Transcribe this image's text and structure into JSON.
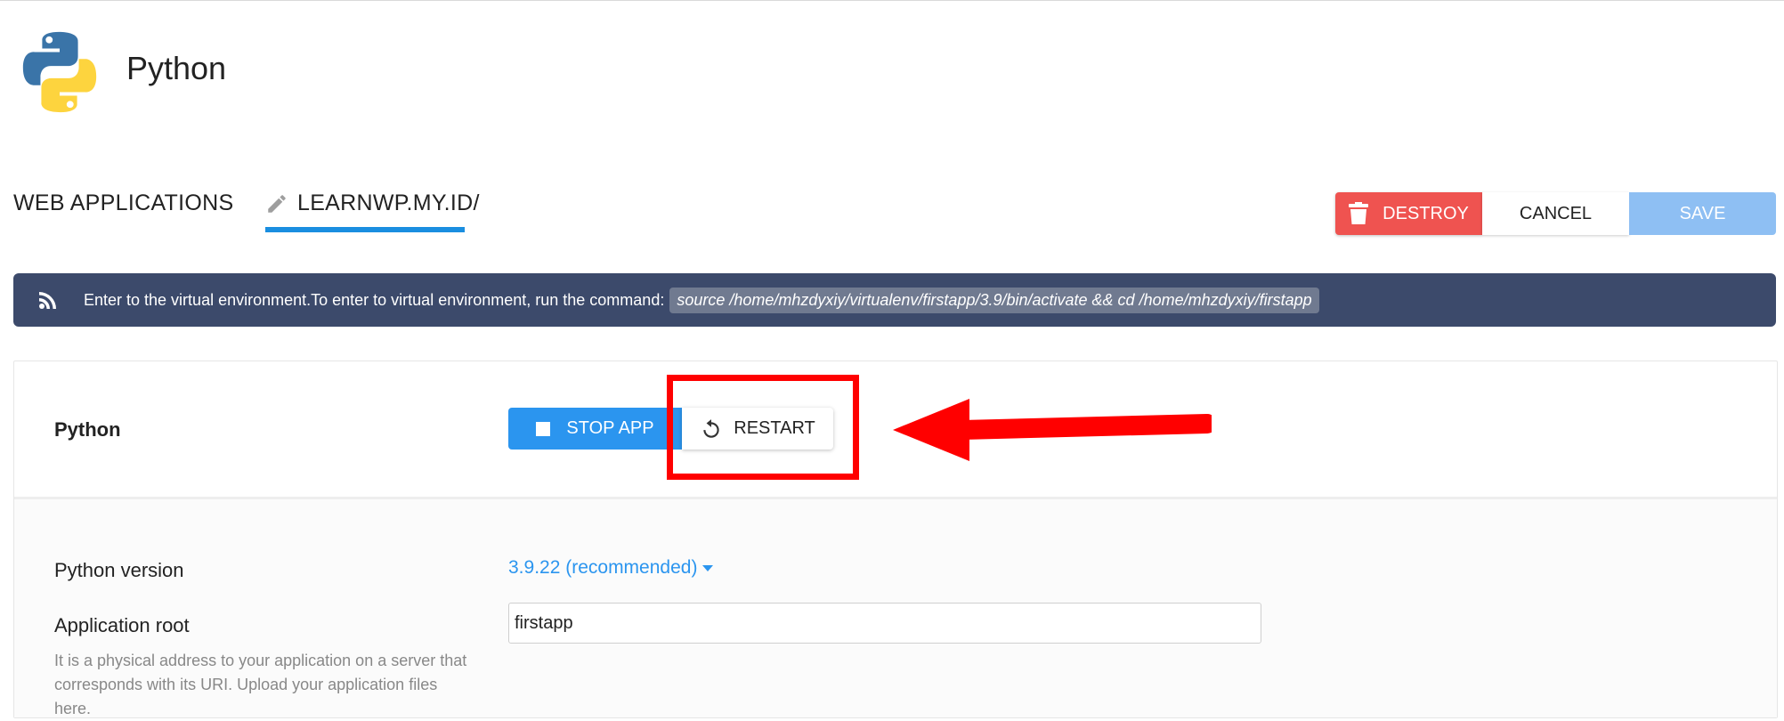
{
  "header": {
    "title": "Python",
    "logo_icon": "python-logo-icon"
  },
  "tabs": [
    {
      "label": "WEB APPLICATIONS"
    },
    {
      "label": "LEARNWP.MY.ID/",
      "icon": "pencil-icon",
      "active": true
    }
  ],
  "actions": {
    "destroy": "DESTROY",
    "cancel": "CANCEL",
    "save": "SAVE"
  },
  "banner": {
    "icon": "rss-icon",
    "text": "Enter to the virtual environment.To enter to virtual environment, run the command:",
    "command": "source /home/mhzdyxiy/virtualenv/firstapp/3.9/bin/activate && cd /home/mhzdyxiy/firstapp"
  },
  "app_panel": {
    "name": "Python",
    "stop_label": "STOP APP",
    "restart_label": "RESTART"
  },
  "form": {
    "version_label": "Python version",
    "version_value": "3.9.22 (recommended)",
    "root_label": "Application root",
    "root_value": "firstapp",
    "root_help": "It is a physical address to your application on a server that corresponds with its URI. Upload your application files here."
  },
  "colors": {
    "accent": "#2b95ef",
    "destroy": "#ef5350",
    "banner_bg": "#3c4a6b",
    "annotation": "#ff0000"
  }
}
